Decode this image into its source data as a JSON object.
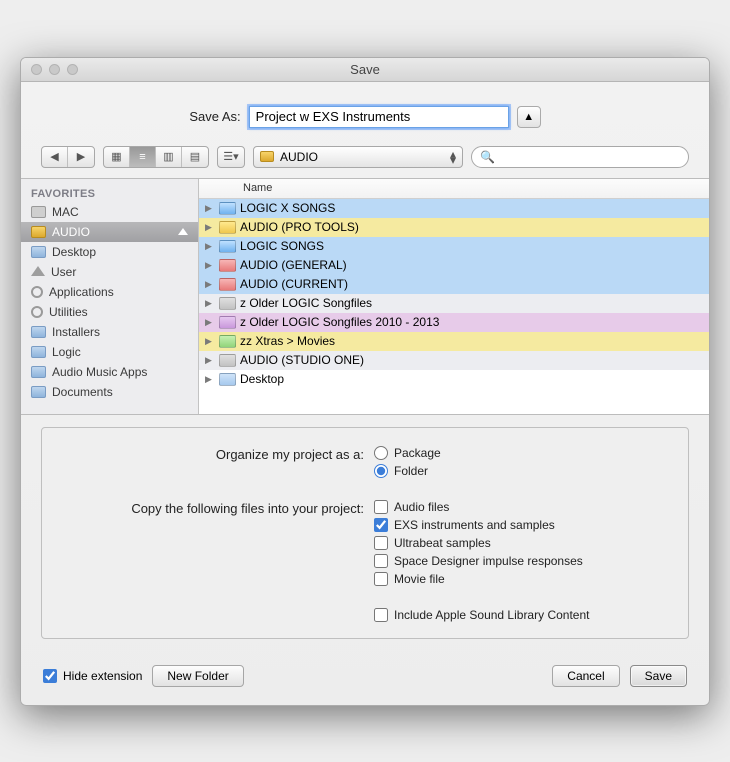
{
  "window": {
    "title": "Save"
  },
  "saveas": {
    "label": "Save As:",
    "value": "Project w EXS Instruments"
  },
  "path_popup": {
    "label": "AUDIO"
  },
  "search": {
    "placeholder": ""
  },
  "sidebar": {
    "section": "FAVORITES",
    "items": [
      {
        "label": "MAC",
        "icon": "hd",
        "selected": false
      },
      {
        "label": "AUDIO",
        "icon": "disk",
        "selected": true
      },
      {
        "label": "Desktop",
        "icon": "fold",
        "selected": false
      },
      {
        "label": "User",
        "icon": "home",
        "selected": false
      },
      {
        "label": "Applications",
        "icon": "gear",
        "selected": false
      },
      {
        "label": "Utilities",
        "icon": "gear",
        "selected": false
      },
      {
        "label": "Installers",
        "icon": "fold",
        "selected": false
      },
      {
        "label": "Logic",
        "icon": "fold",
        "selected": false
      },
      {
        "label": "Audio Music Apps",
        "icon": "fold",
        "selected": false
      },
      {
        "label": "Documents",
        "icon": "fold",
        "selected": false
      }
    ]
  },
  "filelist": {
    "header": "Name",
    "rows": [
      {
        "name": "LOGIC X SONGS",
        "row_color": "blue",
        "folder_color": "blue"
      },
      {
        "name": "AUDIO (PRO TOOLS)",
        "row_color": "yellow",
        "folder_color": "yellow"
      },
      {
        "name": "LOGIC SONGS",
        "row_color": "blue",
        "folder_color": "blue"
      },
      {
        "name": "AUDIO (GENERAL)",
        "row_color": "blue",
        "folder_color": "red"
      },
      {
        "name": "AUDIO (CURRENT)",
        "row_color": "blue",
        "folder_color": "red"
      },
      {
        "name": "z Older LOGIC Songfiles",
        "row_color": "gray",
        "folder_color": "gray"
      },
      {
        "name": "z Older LOGIC Songfiles 2010 - 2013",
        "row_color": "purple",
        "folder_color": "purple"
      },
      {
        "name": "zz Xtras > Movies",
        "row_color": "yellow",
        "folder_color": "green"
      },
      {
        "name": "AUDIO (STUDIO ONE)",
        "row_color": "gray",
        "folder_color": "gray"
      },
      {
        "name": "Desktop",
        "row_color": "white",
        "folder_color": "plain"
      }
    ]
  },
  "options": {
    "organize_label": "Organize my project as a:",
    "radios": [
      {
        "label": "Package",
        "checked": false
      },
      {
        "label": "Folder",
        "checked": true
      }
    ],
    "copy_label": "Copy the following files into your project:",
    "checks": [
      {
        "label": "Audio files",
        "checked": false
      },
      {
        "label": "EXS instruments and samples",
        "checked": true
      },
      {
        "label": "Ultrabeat samples",
        "checked": false
      },
      {
        "label": "Space Designer impulse responses",
        "checked": false
      },
      {
        "label": "Movie file",
        "checked": false
      }
    ],
    "include_label": "Include Apple Sound Library Content",
    "include_checked": false
  },
  "footer": {
    "hide_ext_label": "Hide extension",
    "hide_ext_checked": true,
    "new_folder": "New Folder",
    "cancel": "Cancel",
    "save": "Save"
  }
}
